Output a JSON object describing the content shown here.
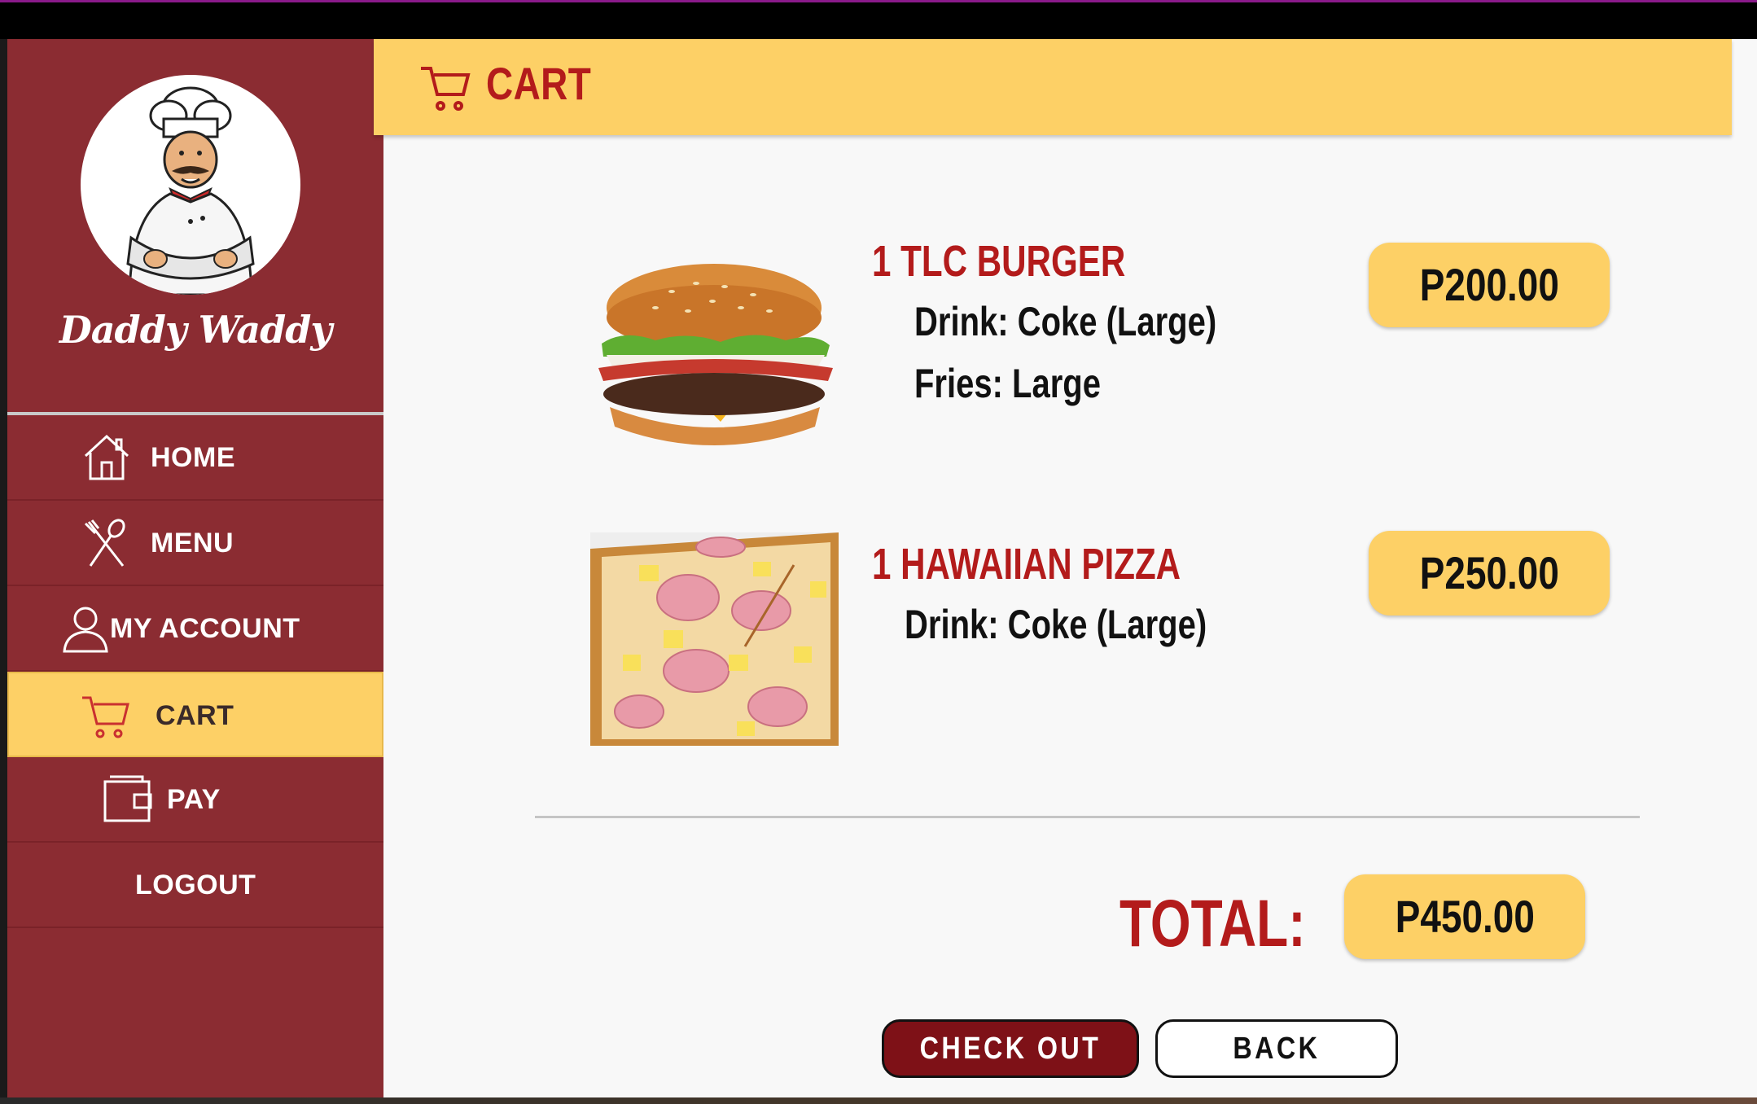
{
  "brand": {
    "name": "Daddy Waddy"
  },
  "nav": {
    "items": [
      {
        "label": "HOME",
        "icon": "home-icon"
      },
      {
        "label": "MENU",
        "icon": "utensils-icon"
      },
      {
        "label": "MY ACCOUNT",
        "icon": "user-icon"
      },
      {
        "label": "CART",
        "icon": "cart-icon",
        "active": true
      },
      {
        "label": "PAY",
        "icon": "wallet-icon"
      },
      {
        "label": "LOGOUT"
      }
    ]
  },
  "header": {
    "title": "CART",
    "icon": "cart-icon"
  },
  "cart": {
    "items": [
      {
        "name": "1 TLC BURGER",
        "options": [
          "Drink: Coke (Large)",
          "Fries: Large"
        ],
        "price": "P200.00"
      },
      {
        "name": "1 HAWAIIAN PIZZA",
        "options": [
          "Drink: Coke (Large)"
        ],
        "price": "P250.00"
      }
    ],
    "total_label": "TOTAL:",
    "total": "P450.00"
  },
  "actions": {
    "checkout": "CHECK OUT",
    "back": "BACK"
  },
  "colors": {
    "sidebar": "#8b2c32",
    "accent": "#fdd066",
    "title_red": "#b31b1b",
    "checkout_btn": "#7e1117"
  }
}
